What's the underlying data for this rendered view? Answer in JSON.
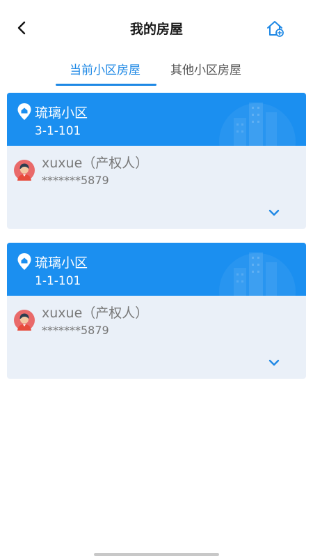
{
  "header": {
    "title": "我的房屋",
    "back_icon": "chevron-left-icon",
    "home_icon": "home-add-icon"
  },
  "tabs": [
    {
      "label": "当前小区房屋",
      "active": true
    },
    {
      "label": "其他小区房屋",
      "active": false
    }
  ],
  "houses": [
    {
      "community": "琉璃小区",
      "room": "3-1-101",
      "owner": "xuxue（产权人）",
      "phone": "*******5879"
    },
    {
      "community": "琉璃小区",
      "room": "1-1-101",
      "owner": "xuxue（产权人）",
      "phone": "*******5879"
    }
  ],
  "colors": {
    "accent": "#1e88e5",
    "card_header": "#1b8ff0",
    "card_body": "#eaf0f8"
  }
}
